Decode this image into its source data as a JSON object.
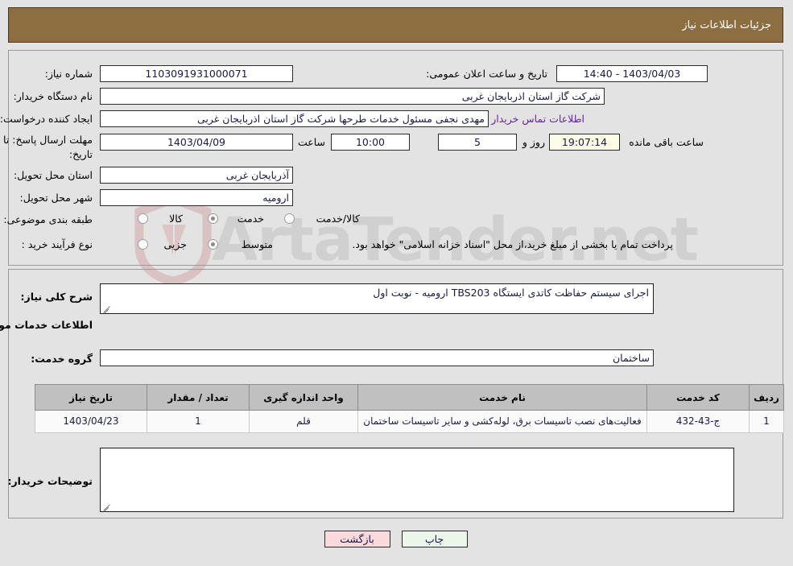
{
  "header": {
    "title": "جزئیات اطلاعات نیاز",
    "bg_color": "#8d6e41"
  },
  "watermark": {
    "text": "ArtaTender.net"
  },
  "top_panel": {
    "need_number_label": "شماره نیاز:",
    "need_number_value": "1103091931000071",
    "public_announce_label": "تاریخ و ساعت اعلان عمومی:",
    "public_announce_value": "1403/04/03 - 14:40",
    "buyer_org_label": "نام دستگاه خریدار:",
    "buyer_org_value": "شرکت گاز استان اذربایجان غربی",
    "requester_label": "ایجاد کننده درخواست:",
    "requester_value": "مهدی نجفی مسئول خدمات طرحها شرکت گاز استان اذربایجان غربی",
    "contact_link": "اطلاعات تماس خریدار",
    "deadline_label_line1": "مهلت ارسال پاسخ: تا",
    "deadline_label_line2": "تاریخ:",
    "deadline_date": "1403/04/09",
    "hour_label": "ساعت",
    "deadline_time": "10:00",
    "days_value": "5",
    "days_label": "روز و",
    "countdown_value": "19:07:14",
    "remaining_label": "ساعت باقی مانده",
    "province_label": "استان محل تحویل:",
    "province_value": "آذربایجان غربی",
    "city_label": "شهر محل تحویل:",
    "city_value": "ارومیه",
    "category_label": "طبقه بندی موضوعی:",
    "category_options": [
      {
        "label": "کالا",
        "checked": false
      },
      {
        "label": "خدمت",
        "checked": true
      },
      {
        "label": "کالا/خدمت",
        "checked": false
      }
    ],
    "process_label": "نوع فرآیند خرید :",
    "process_options": [
      {
        "label": "جزیی",
        "checked": false
      },
      {
        "label": "متوسط",
        "checked": true
      }
    ],
    "payment_note": "پرداخت تمام یا بخشی از مبلغ خرید،از محل \"اسناد خزانه اسلامی\" خواهد بود."
  },
  "bottom_panel": {
    "need_desc_label": "شرح کلی نیاز:",
    "need_desc_value": "اجرای سیستم حفاظت کاتدی ایستگاه TBS203 ارومیه - نوبت اول",
    "services_heading": "اطلاعات خدمات مورد نیاز",
    "service_group_label": "گروه خدمت:",
    "service_group_value": "ساختمان",
    "buyer_notes_label": "توضیحات خریدار:",
    "buyer_notes_value": ""
  },
  "table": {
    "columns": [
      "ردیف",
      "کد خدمت",
      "نام خدمت",
      "واحد اندازه گیری",
      "تعداد / مقدار",
      "تاریخ نیاز"
    ],
    "rows": [
      {
        "radif": "1",
        "code": "ج-43-432",
        "name": "فعالیت‌های نصب تاسیسات برق، لوله‌کشی و سایر تاسیسات ساختمان",
        "unit": "قلم",
        "qty": "1",
        "date": "1403/04/23"
      }
    ]
  },
  "buttons": {
    "print_label": "چاپ",
    "back_label": "بازگشت"
  }
}
